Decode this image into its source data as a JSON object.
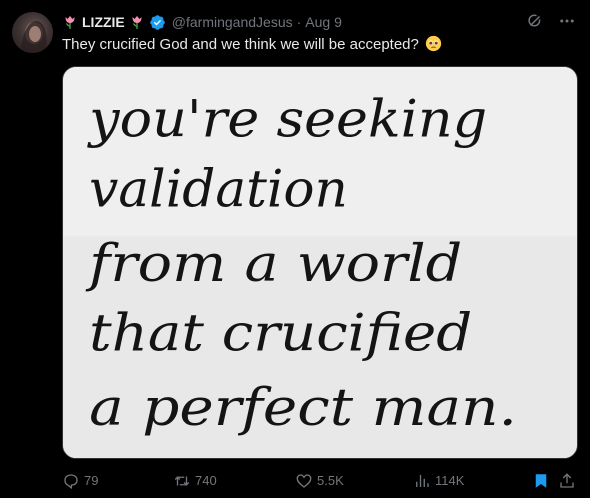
{
  "author": {
    "display_name": "LIZZIE",
    "handle": "@farmingandJesus",
    "separator": "·",
    "date": "Aug 9",
    "verified": true
  },
  "tweet": {
    "text": "They crucified God and we think we will be accepted?",
    "emoji": "pleading-face-icon"
  },
  "media": {
    "lines": [
      "you're seeking",
      "validation",
      "from a world",
      "that crucified",
      "a perfect man."
    ]
  },
  "actions": {
    "replies": "79",
    "retweets": "740",
    "likes": "5.5K",
    "views": "114K"
  },
  "colors": {
    "background": "#000000",
    "text": "#e7e9ea",
    "muted": "#71767b",
    "accent": "#1d9bf0",
    "verified": "#1d9bf0"
  }
}
